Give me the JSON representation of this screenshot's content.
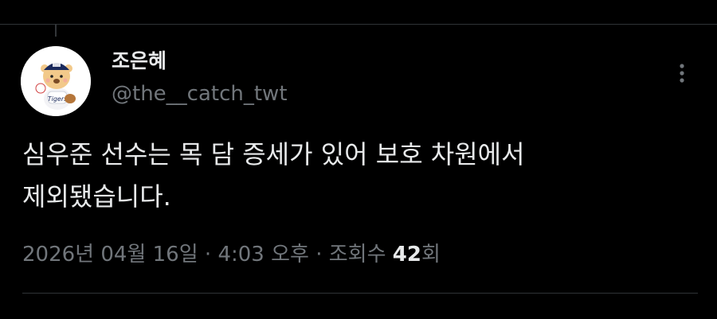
{
  "author": {
    "display_name": "조은혜",
    "handle": "@the__catch_twt",
    "avatar_icon": "bear-mascot-icon"
  },
  "more_menu_icon": "more-vertical-icon",
  "tweet": {
    "text": "심우준 선수는 목 담 증세가 있어 보호 차원에서\n제외됐습니다."
  },
  "meta": {
    "date": "2026년 04월 16일",
    "sep1": " · ",
    "time": "4:03 오후",
    "sep2": " · ",
    "views_label": "조회수 ",
    "views_count": "42",
    "views_suffix": "회"
  },
  "colors": {
    "background": "#000000",
    "text_primary": "#e7e9ea",
    "text_secondary": "#71767b",
    "border": "#2f3336"
  }
}
